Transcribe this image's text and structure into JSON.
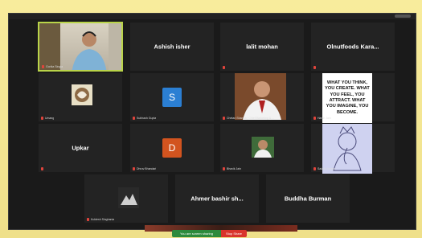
{
  "participants": [
    {
      "id": "p1",
      "name": "",
      "caption": "Gorika Singla",
      "type": "video"
    },
    {
      "id": "p2",
      "name": "Ashish isher",
      "caption": "",
      "type": "name"
    },
    {
      "id": "p3",
      "name": "lalit mohan",
      "caption": "",
      "type": "name"
    },
    {
      "id": "p4",
      "name": "Olnutfoods Kara...",
      "caption": "",
      "type": "name"
    },
    {
      "id": "p5",
      "name": "",
      "caption": "Umang",
      "type": "photo"
    },
    {
      "id": "p6",
      "name": "",
      "caption": "Subhash Gupta",
      "type": "letter",
      "letter": "S",
      "color": "#2b7fd3"
    },
    {
      "id": "p7",
      "name": "",
      "caption": "Chetan Sharma | Chief Marketing & ...",
      "type": "photo"
    },
    {
      "id": "p8",
      "name": "",
      "caption": "Harsh Jain",
      "type": "quote",
      "quote": "WHAT YOU THINK, YOU CREATE. WHAT YOU FEEL, YOU ATTRACT. WHAT YOU IMAGINE, YOU BECOME."
    },
    {
      "id": "p9",
      "name": "Upkar",
      "caption": "",
      "type": "name"
    },
    {
      "id": "p10",
      "name": "",
      "caption": "Dhruv Bhandari",
      "type": "letter",
      "letter": "D",
      "color": "#d2541f"
    },
    {
      "id": "p11",
      "name": "",
      "caption": "Bhavik Jain",
      "type": "photo"
    },
    {
      "id": "p12",
      "name": "",
      "caption": "Sakshi Juneja",
      "type": "ganesha"
    },
    {
      "id": "p13",
      "name": "",
      "caption": "Kuldesh Singhania",
      "type": "photo"
    },
    {
      "id": "p14",
      "name": "Ahmer bashir sh...",
      "caption": "",
      "type": "name"
    },
    {
      "id": "p15",
      "name": "Buddha Burman",
      "caption": "",
      "type": "name"
    }
  ],
  "sharing": {
    "status_label": "You are screen sharing",
    "stop_label": "Stop Share"
  },
  "colors": {
    "active_border": "#b9d449",
    "muted_icon": "#e0443c",
    "share_green": "#2d8a3c",
    "stop_red": "#d9342b"
  }
}
